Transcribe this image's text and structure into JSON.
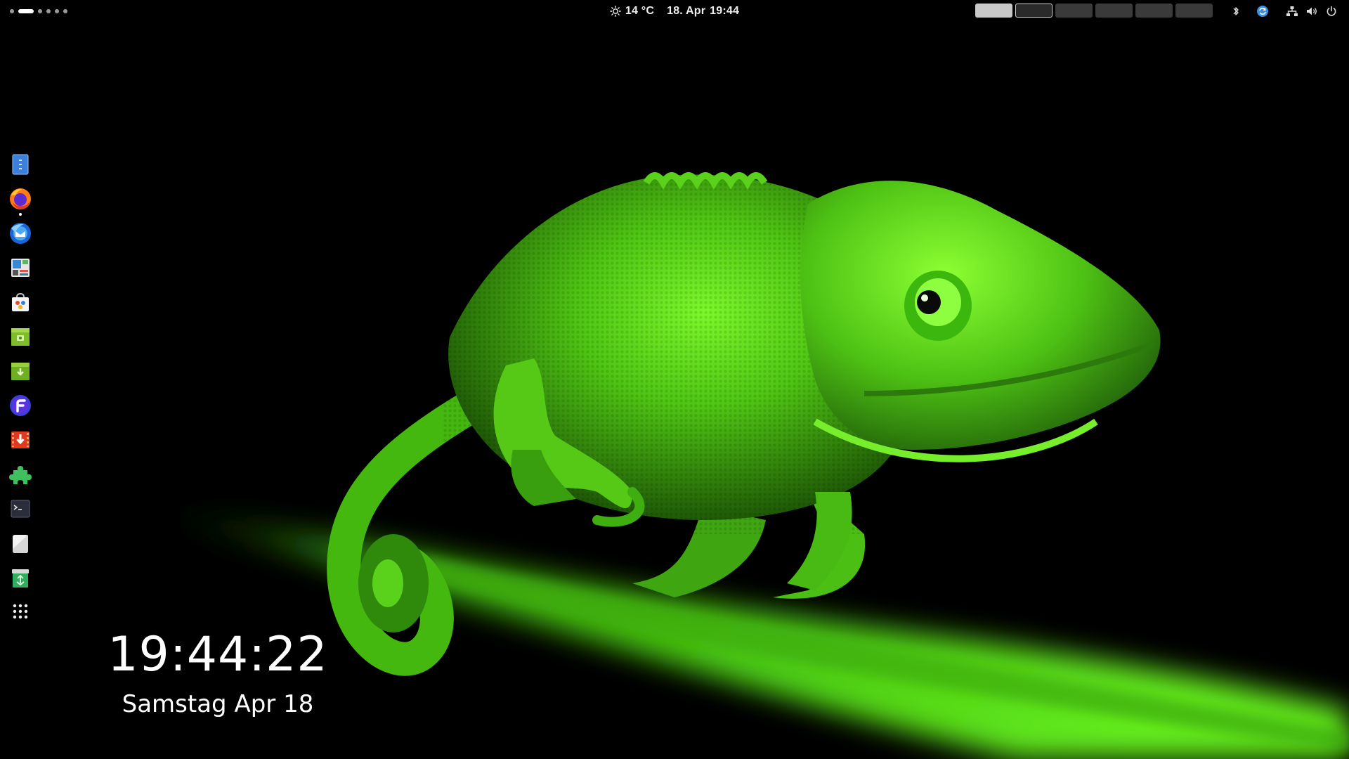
{
  "topbar": {
    "workspace_count": 6,
    "active_workspace": 2,
    "weather": {
      "icon": "sun-icon",
      "temperature": "14 °C"
    },
    "date": "18. Apr",
    "time": "19:44",
    "tray_icons": [
      "bluetooth-icon",
      "sync-icon",
      "network-icon",
      "volume-icon",
      "power-icon"
    ]
  },
  "dock": {
    "items": [
      {
        "name": "Files",
        "icon": "files-icon",
        "running": false
      },
      {
        "name": "Firefox",
        "icon": "firefox-icon",
        "running": true
      },
      {
        "name": "Thunderbird",
        "icon": "thunderbird-icon",
        "running": false
      },
      {
        "name": "System Monitor",
        "icon": "system-monitor-icon",
        "running": false
      },
      {
        "name": "Software",
        "icon": "software-store-icon",
        "running": false
      },
      {
        "name": "Archive Manager",
        "icon": "archive-icon",
        "running": false
      },
      {
        "name": "Package Installer",
        "icon": "package-install-icon",
        "running": false
      },
      {
        "name": "Fedora Media Writer",
        "icon": "fedora-icon",
        "running": false
      },
      {
        "name": "Video Downloader",
        "icon": "video-download-icon",
        "running": false
      },
      {
        "name": "Extensions",
        "icon": "extensions-icon",
        "running": false
      },
      {
        "name": "Terminal",
        "icon": "terminal-icon",
        "running": false
      },
      {
        "name": "Text Editor",
        "icon": "text-editor-icon",
        "running": false
      },
      {
        "name": "Trash",
        "icon": "trash-icon",
        "running": false
      },
      {
        "name": "Show Applications",
        "icon": "app-grid-icon",
        "running": false
      }
    ]
  },
  "desklet": {
    "time": "19:44:22",
    "date": "Samstag Apr 18"
  },
  "colors": {
    "wallpaper_green": "#5fe81a",
    "wallpaper_dark_green": "#1f5a06",
    "bar_background": "#000000"
  }
}
